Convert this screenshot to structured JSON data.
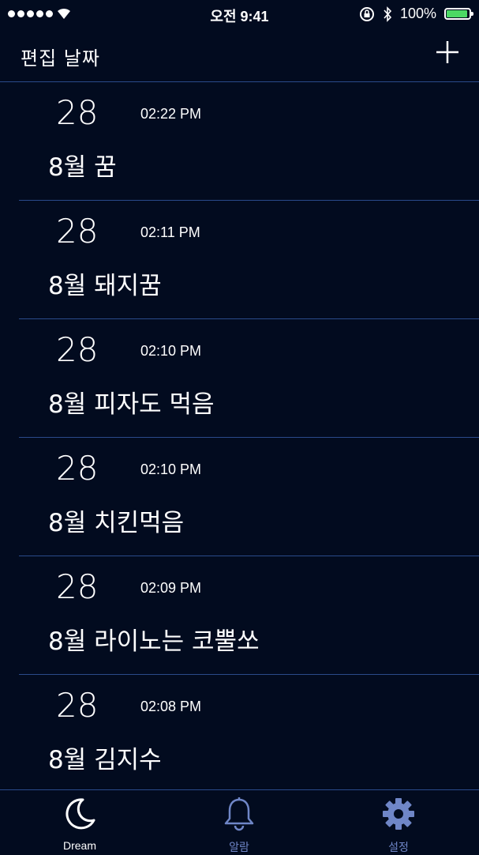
{
  "status_bar": {
    "time": "오전 9:41",
    "battery_percent": "100%",
    "battery_level": 1.0,
    "signal_bars": 5
  },
  "nav": {
    "title": "편집  날짜",
    "add_icon": "plus-icon"
  },
  "entries": [
    {
      "day": "28",
      "time": "02:22 PM",
      "title": "8월 꿈"
    },
    {
      "day": "28",
      "time": "02:11 PM",
      "title": "8월 돼지꿈"
    },
    {
      "day": "28",
      "time": "02:10 PM",
      "title": "8월 피자도 먹음"
    },
    {
      "day": "28",
      "time": "02:10 PM",
      "title": "8월 치킨먹음"
    },
    {
      "day": "28",
      "time": "02:09 PM",
      "title": "8월 라이노는 코뿔쏘"
    },
    {
      "day": "28",
      "time": "02:08 PM",
      "title": "8월 김지수"
    }
  ],
  "tabs": [
    {
      "label": "Dream",
      "icon": "moon-icon",
      "active": true
    },
    {
      "label": "알람",
      "icon": "bell-icon",
      "active": false
    },
    {
      "label": "설정",
      "icon": "gear-icon",
      "active": false
    }
  ],
  "colors": {
    "background": "#020b1f",
    "divider": "#2a4a8a",
    "inactive_tab": "#6f86c7",
    "battery": "#4cd964"
  }
}
